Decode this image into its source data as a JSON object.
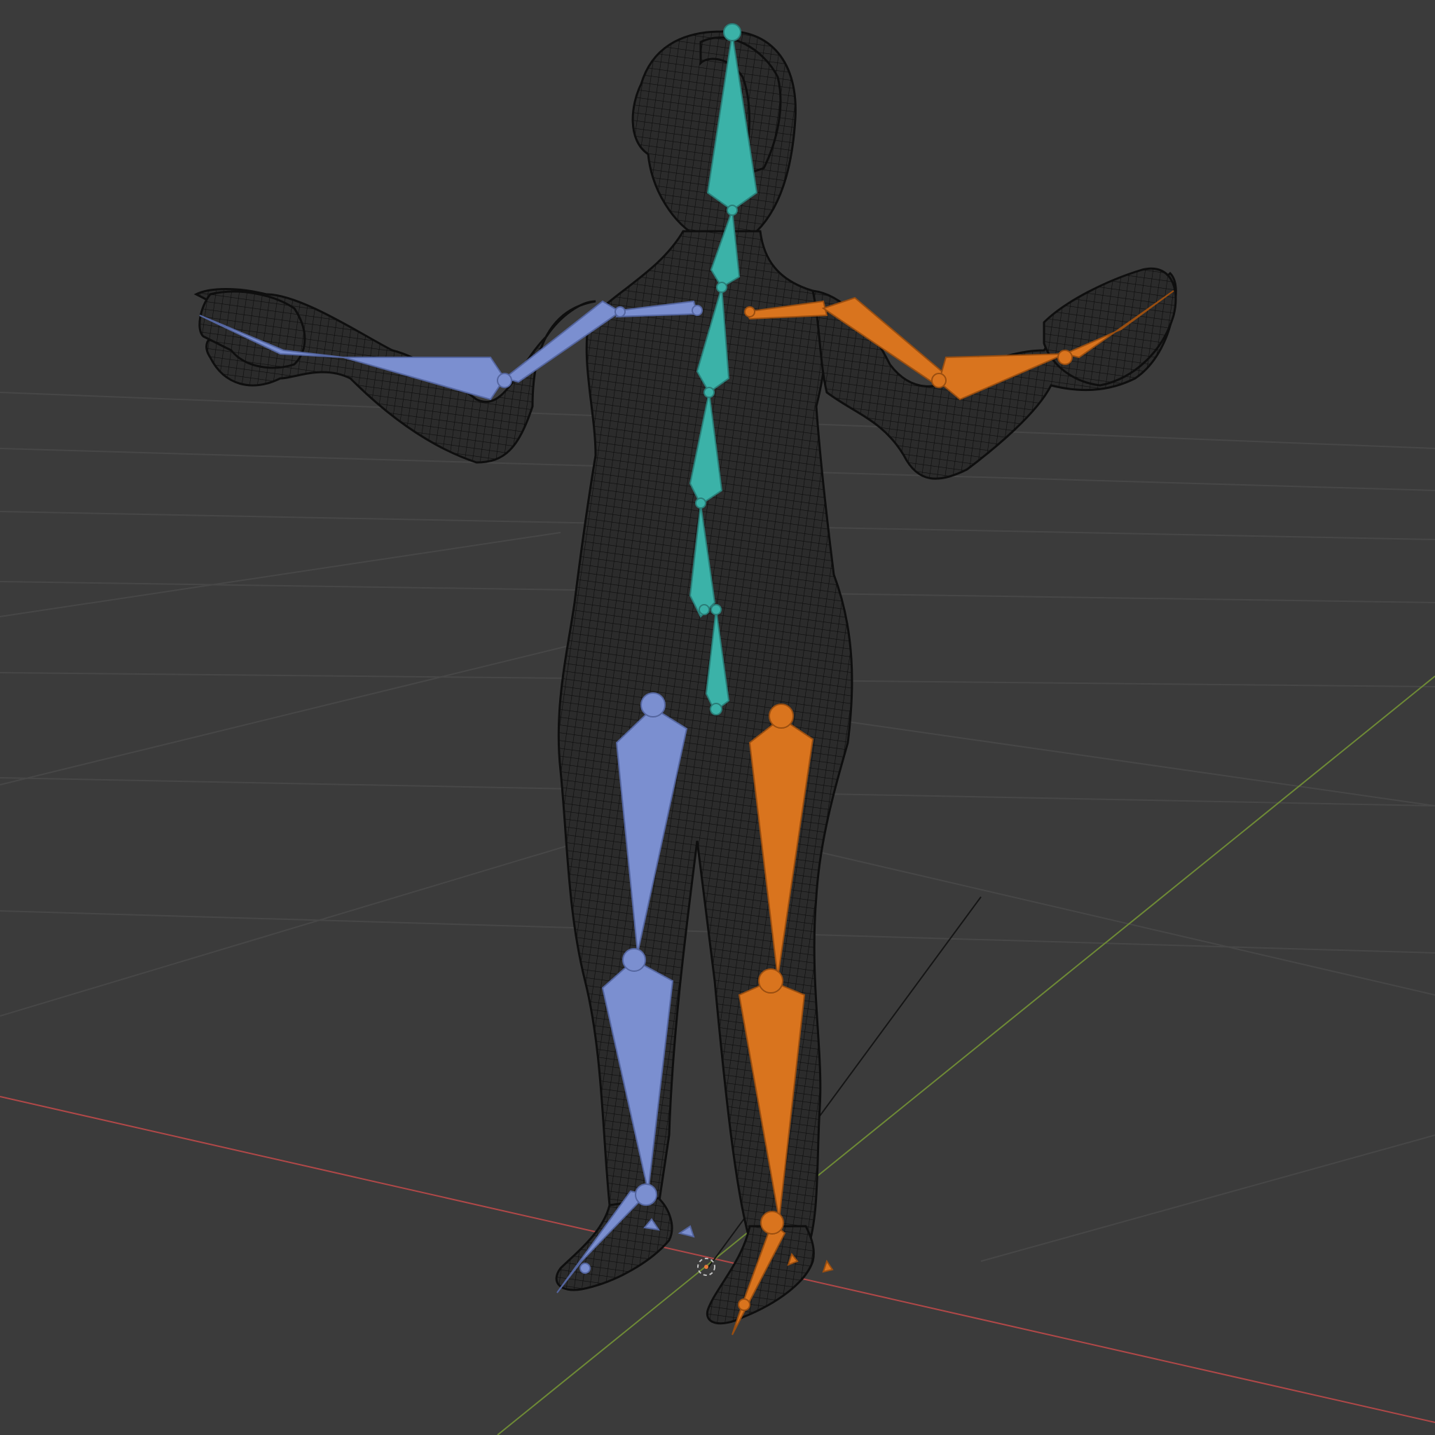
{
  "viewport": {
    "background": "#3b3b3b",
    "grid_color": "#4a4a4a",
    "x_axis_color": "#b84a4a",
    "y_axis_color": "#6f8a3a"
  },
  "mesh": {
    "wire_color": "#111111",
    "fill_color": "#262626"
  },
  "armature": {
    "center_color": "#3fb0a8",
    "left_color": "#7b8fd0",
    "right_color": "#d9741e"
  }
}
